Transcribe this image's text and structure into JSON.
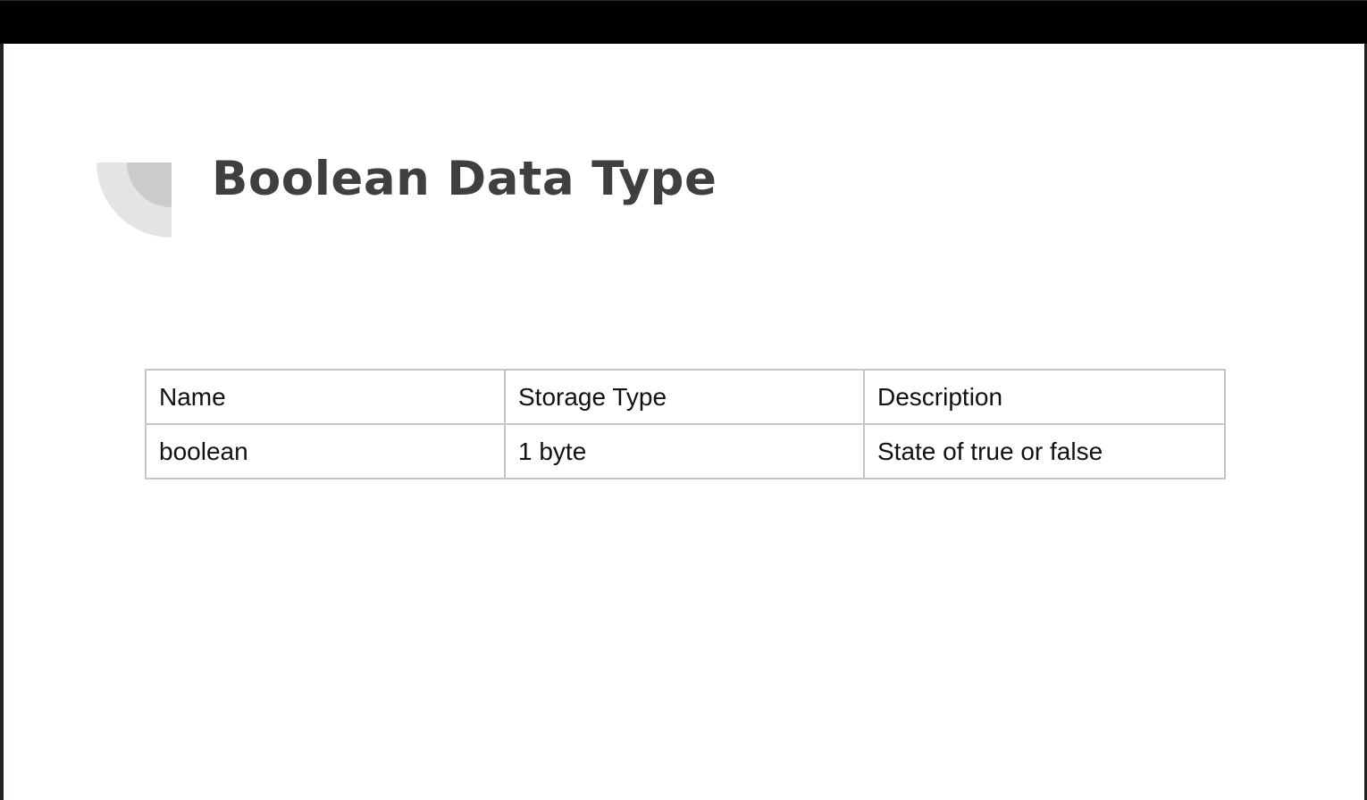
{
  "slide": {
    "title": "Boolean Data Type",
    "decoration_icon": "quarter-circle-decoration",
    "colors": {
      "title": "#3f3f3f",
      "table_border": "#c6c6c6",
      "deco_outer": "#e4e4e4",
      "deco_inner": "#cbcbcb",
      "top_bar": "#000000"
    }
  },
  "table": {
    "headers": [
      "Name",
      "Storage Type",
      "Description"
    ],
    "rows": [
      [
        "boolean",
        "1 byte",
        "State of true or false"
      ]
    ]
  }
}
